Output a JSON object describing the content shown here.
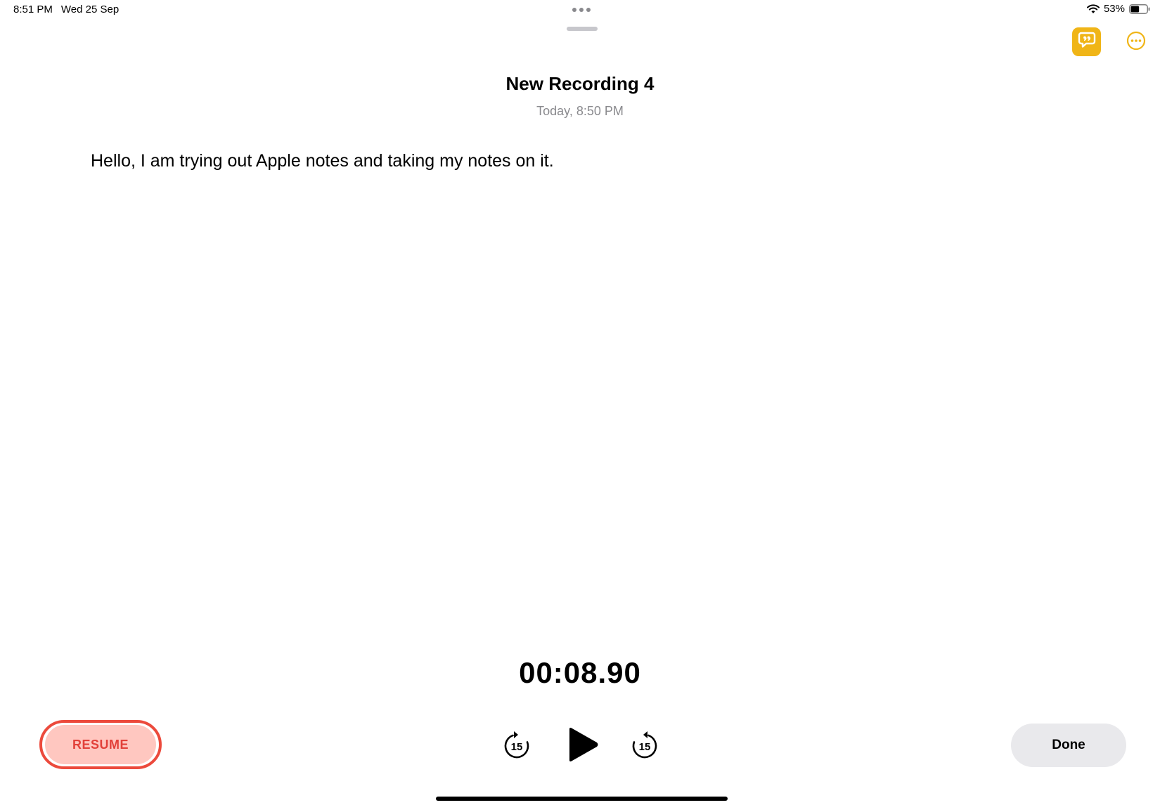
{
  "status_bar": {
    "time": "8:51 PM",
    "date": "Wed 25 Sep",
    "battery_percent": "53%",
    "battery_level": 0.53,
    "icons": [
      "wifi-icon",
      "battery-icon"
    ]
  },
  "header": {
    "title": "New Recording 4",
    "subtitle": "Today, 8:50 PM"
  },
  "toolbar": {
    "transcript_icon": "speech-bubble-quote-icon",
    "more_icon": "ellipsis-circle-icon",
    "accent_color": "#f0b517"
  },
  "transcript": {
    "text": "Hello, I am trying out Apple notes and taking my notes on it."
  },
  "playback": {
    "elapsed": "00:08.90",
    "skip_back_label": "15",
    "skip_forward_label": "15",
    "play_icon": "play-icon"
  },
  "controls": {
    "resume_label": "RESUME",
    "done_label": "Done",
    "resume_color": "#ec4a3c"
  }
}
